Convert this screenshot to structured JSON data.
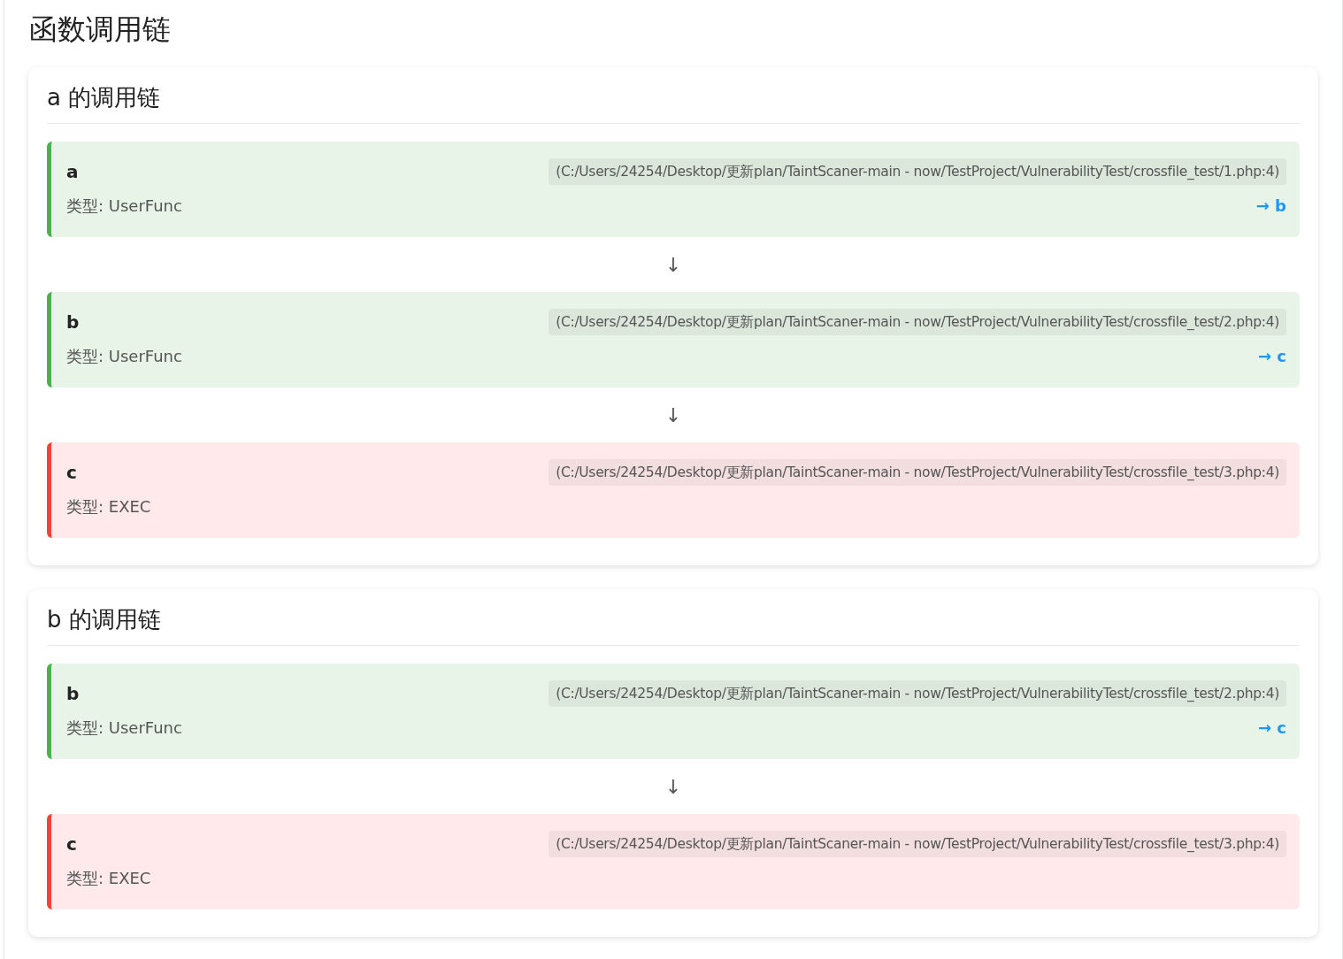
{
  "title": "函数调用链",
  "chains": [
    {
      "heading": "a 的调用链",
      "nodes": [
        {
          "kind": "userfunc",
          "name": "a",
          "location": "(C:/Users/24254/Desktop/更新plan/TaintScaner-main - now/TestProject/VulnerabilityTest/crossfile_test/1.php:4)",
          "type": "类型: UserFunc",
          "next": "→ b",
          "arrow_below": "↓"
        },
        {
          "kind": "userfunc",
          "name": "b",
          "location": "(C:/Users/24254/Desktop/更新plan/TaintScaner-main - now/TestProject/VulnerabilityTest/crossfile_test/2.php:4)",
          "type": "类型: UserFunc",
          "next": "→ c",
          "arrow_below": "↓"
        },
        {
          "kind": "exec",
          "name": "c",
          "location": "(C:/Users/24254/Desktop/更新plan/TaintScaner-main - now/TestProject/VulnerabilityTest/crossfile_test/3.php:4)",
          "type": "类型: EXEC"
        }
      ]
    },
    {
      "heading": "b 的调用链",
      "nodes": [
        {
          "kind": "userfunc",
          "name": "b",
          "location": "(C:/Users/24254/Desktop/更新plan/TaintScaner-main - now/TestProject/VulnerabilityTest/crossfile_test/2.php:4)",
          "type": "类型: UserFunc",
          "next": "→ c",
          "arrow_below": "↓"
        },
        {
          "kind": "exec",
          "name": "c",
          "location": "(C:/Users/24254/Desktop/更新plan/TaintScaner-main - now/TestProject/VulnerabilityTest/crossfile_test/3.php:4)",
          "type": "类型: EXEC"
        }
      ]
    }
  ]
}
